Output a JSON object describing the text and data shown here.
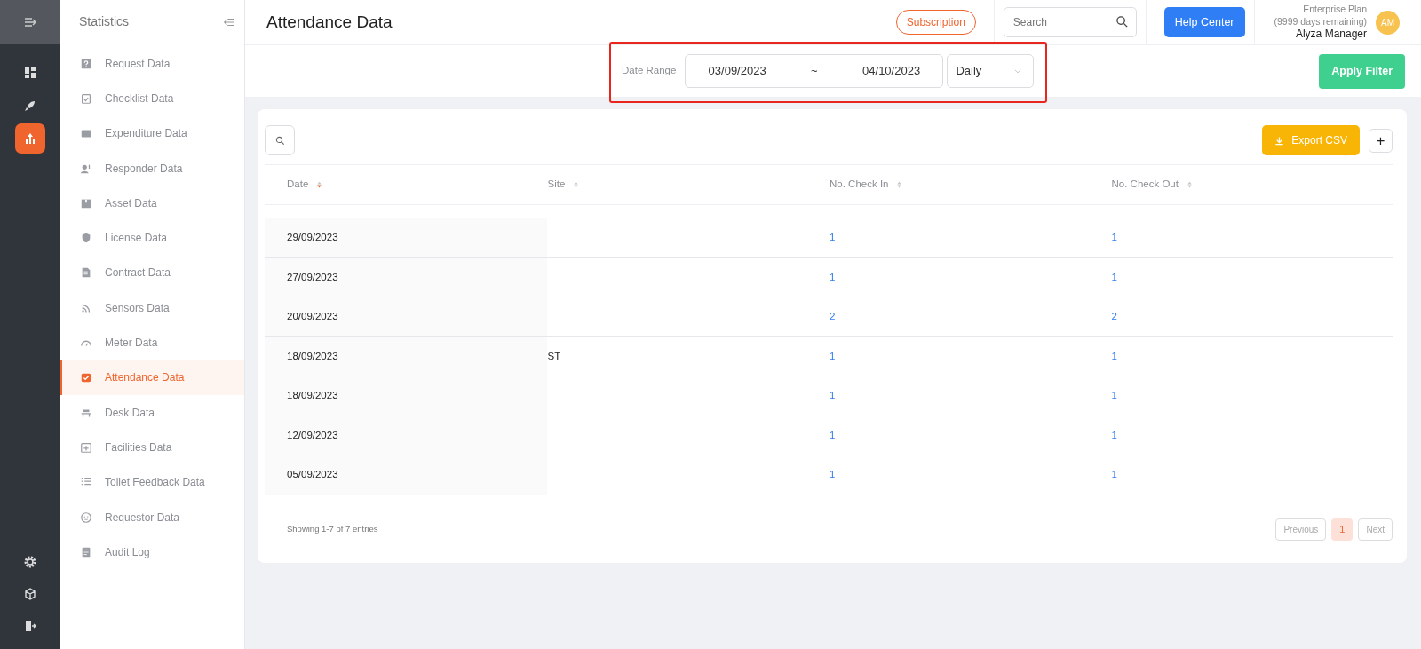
{
  "rail": {
    "items": [
      {
        "selected": false
      },
      {
        "selected": false
      },
      {
        "selected": true
      }
    ]
  },
  "sidebar": {
    "title": "Statistics",
    "items": [
      {
        "label": "Request Data",
        "selected": false
      },
      {
        "label": "Checklist Data",
        "selected": false
      },
      {
        "label": "Expenditure Data",
        "selected": false
      },
      {
        "label": "Responder Data",
        "selected": false
      },
      {
        "label": "Asset Data",
        "selected": false
      },
      {
        "label": "License Data",
        "selected": false
      },
      {
        "label": "Contract Data",
        "selected": false
      },
      {
        "label": "Sensors Data",
        "selected": false
      },
      {
        "label": "Meter Data",
        "selected": false
      },
      {
        "label": "Attendance Data",
        "selected": true
      },
      {
        "label": "Desk Data",
        "selected": false
      },
      {
        "label": "Facilities Data",
        "selected": false
      },
      {
        "label": "Toilet Feedback Data",
        "selected": false
      },
      {
        "label": "Requestor Data",
        "selected": false
      },
      {
        "label": "Audit Log",
        "selected": false
      }
    ]
  },
  "header": {
    "title": "Attendance Data",
    "subscription": "Subscription",
    "search": {
      "placeholder": "Search"
    },
    "help": "Help Center",
    "plan": "Enterprise Plan",
    "remaining": "(9999 days remaining)",
    "user": "Alyza Manager",
    "avatar": "AM"
  },
  "filter": {
    "label": "Date Range",
    "start": "03/09/2023",
    "separator": "~",
    "end": "04/10/2023",
    "period": "Daily",
    "apply": "Apply Filter"
  },
  "table": {
    "export": "Export CSV",
    "add": "+",
    "columns": [
      {
        "label": "Date",
        "sorted_desc": true
      },
      {
        "label": "Site",
        "sorted_desc": false
      },
      {
        "label": "No. Check In",
        "sorted_desc": false
      },
      {
        "label": "No. Check Out",
        "sorted_desc": false
      }
    ],
    "rows": [
      [
        "29/09/2023",
        "",
        "1",
        "1"
      ],
      [
        "27/09/2023",
        "",
        "1",
        "1"
      ],
      [
        "20/09/2023",
        "",
        "2",
        "2"
      ],
      [
        "18/09/2023",
        "ST",
        "1",
        "1"
      ],
      [
        "18/09/2023",
        "",
        "1",
        "1"
      ],
      [
        "12/09/2023",
        "",
        "1",
        "1"
      ],
      [
        "05/09/2023",
        "",
        "1",
        "1"
      ]
    ],
    "summary": "Showing 1-7 of 7 entries",
    "pagination": {
      "previous": {
        "label": "Previous",
        "disabled": true
      },
      "pages": [
        {
          "label": "1",
          "selected": true
        }
      ],
      "next": {
        "label": "Next",
        "disabled": true
      }
    }
  }
}
